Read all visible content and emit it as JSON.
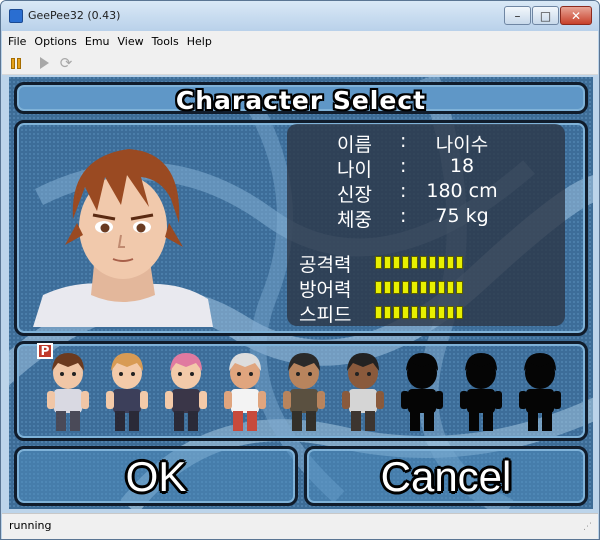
{
  "window": {
    "title": "GeePee32 (0.43)",
    "minimize": "–",
    "maximize": "□",
    "close": "✕"
  },
  "menu": [
    "File",
    "Options",
    "Emu",
    "View",
    "Tools",
    "Help"
  ],
  "toolbar": {
    "icons": [
      "pause-icon",
      "play-icon",
      "reload-icon"
    ],
    "reload_glyph": "⟳"
  },
  "game": {
    "title": "Character Select",
    "profile": [
      {
        "label": "이름",
        "sep": ":",
        "value": "나이수"
      },
      {
        "label": "나이",
        "sep": ":",
        "value": "18"
      },
      {
        "label": "신장",
        "sep": ":",
        "value": "180 cm"
      },
      {
        "label": "체중",
        "sep": ":",
        "value": "75 kg"
      }
    ],
    "gauges": [
      {
        "label": "공격력",
        "level": 10
      },
      {
        "label": "방어력",
        "level": 10
      },
      {
        "label": "스피드",
        "level": 10
      }
    ],
    "roster_marker": "P",
    "roster_count": 9,
    "locked_count": 3,
    "ok": "OK",
    "cancel": "Cancel"
  },
  "colors": {
    "accent_panel": "#5f97c7",
    "gauge": "#e8f000",
    "stats_bg": "#2c3444"
  },
  "status": {
    "text": "running"
  }
}
